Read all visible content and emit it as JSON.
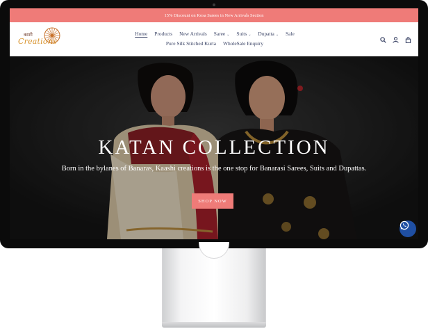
{
  "announcement": {
    "text": "15% Discount on Kosa Sarees in New Arrivals Section"
  },
  "logo": {
    "hindi_text": "काशी",
    "script_text": "Creations"
  },
  "nav": {
    "row1": [
      {
        "label": "Home",
        "active": true,
        "caret": false
      },
      {
        "label": "Products",
        "active": false,
        "caret": false
      },
      {
        "label": "New Arrivals",
        "active": false,
        "caret": false
      },
      {
        "label": "Saree",
        "active": false,
        "caret": true
      },
      {
        "label": "Suits",
        "active": false,
        "caret": true
      },
      {
        "label": "Dupatta",
        "active": false,
        "caret": true
      },
      {
        "label": "Sale",
        "active": false,
        "caret": false
      }
    ],
    "row2": [
      {
        "label": "Pure Silk Stitched Kurta"
      },
      {
        "label": "WholeSale Enquiry"
      }
    ],
    "caret_glyph": "⌄"
  },
  "header_icons": [
    "search-icon",
    "account-icon",
    "cart-icon"
  ],
  "hero": {
    "title": "KATAN COLLECTION",
    "subtitle": "Born in the bylanes of Banaras, Kaashi creations is the one stop for Banarasi Sarees, Suits and Dupattas.",
    "button_label": "SHOP NOW"
  },
  "colors": {
    "accent": "#ef7b78",
    "nav_text": "#3b4466",
    "whatsapp": "#1f4fa3"
  }
}
